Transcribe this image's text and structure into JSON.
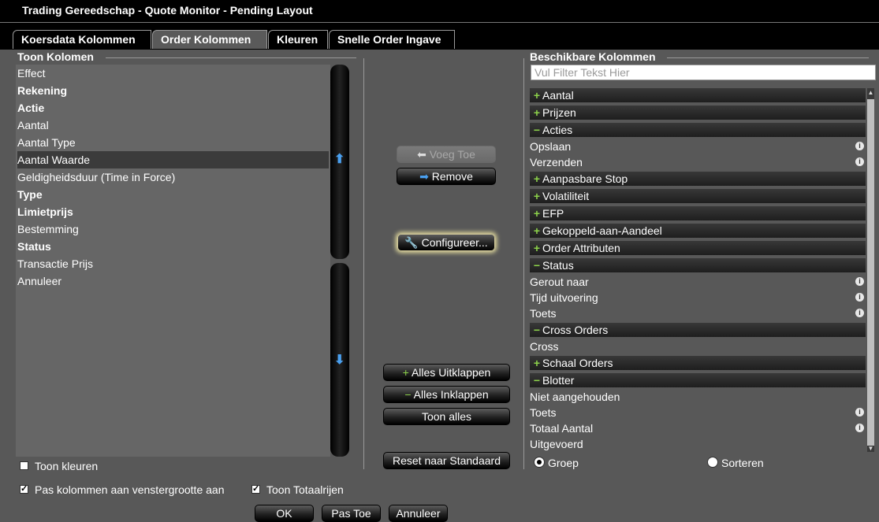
{
  "window": {
    "title": "Trading Gereedschap - Quote Monitor - Pending Layout"
  },
  "tabs": [
    {
      "label": "Koersdata Kolommen"
    },
    {
      "label": "Order Kolommen"
    },
    {
      "label": "Kleuren"
    },
    {
      "label": "Snelle Order Ingave"
    }
  ],
  "left": {
    "title": "Toon Kolomen",
    "items": [
      {
        "label": "Effect"
      },
      {
        "label": "Rekening"
      },
      {
        "label": "Actie"
      },
      {
        "label": "Aantal"
      },
      {
        "label": "Aantal Type"
      },
      {
        "label": "Aantal Waarde"
      },
      {
        "label": "Geldigheidsduur (Time in Force)"
      },
      {
        "label": "Type"
      },
      {
        "label": "Limietprijs"
      },
      {
        "label": "Bestemming"
      },
      {
        "label": "Status"
      },
      {
        "label": "Transactie Prijs"
      },
      {
        "label": "Annuleer"
      }
    ],
    "show_colors_label": "Toon kleuren"
  },
  "middle": {
    "add_label": "Voeg Toe",
    "remove_label": "Remove",
    "configure_label": "Configureer...",
    "expand_all_label": "Alles Uitklappen",
    "collapse_all_label": "Alles Inklappen",
    "show_all_label": "Toon alles",
    "reset_label": "Reset naar Standaard"
  },
  "right": {
    "title": "Beschikbare Kolommen",
    "filter_placeholder": "Vul Filter Tekst Hier",
    "groups": [
      {
        "label": "Aantal",
        "sign": "+"
      },
      {
        "label": "Prijzen",
        "sign": "+"
      },
      {
        "label": "Acties",
        "sign": "−"
      },
      {
        "label": "Opslaan",
        "item": true,
        "info": true
      },
      {
        "label": "Verzenden",
        "item": true,
        "info": true
      },
      {
        "label": "Aanpasbare Stop",
        "sign": "+"
      },
      {
        "label": "Volatiliteit",
        "sign": "+"
      },
      {
        "label": "EFP",
        "sign": "+"
      },
      {
        "label": "Gekoppeld-aan-Aandeel",
        "sign": "+"
      },
      {
        "label": "Order Attributen",
        "sign": "+"
      },
      {
        "label": "Status",
        "sign": "−"
      },
      {
        "label": "Gerout naar",
        "item": true,
        "info": true
      },
      {
        "label": "Tijd uitvoering",
        "item": true,
        "info": true
      },
      {
        "label": "Toets",
        "item": true,
        "info": true
      },
      {
        "label": "Cross Orders",
        "sign": "−"
      },
      {
        "label": "Cross",
        "item": true,
        "info": false
      },
      {
        "label": "Schaal Orders",
        "sign": "+"
      },
      {
        "label": "Blotter",
        "sign": "−"
      },
      {
        "label": "Niet aangehouden",
        "item": true,
        "info": false
      },
      {
        "label": "Toets",
        "item": true,
        "info": true
      },
      {
        "label": "Totaal Aantal",
        "item": true,
        "info": true
      },
      {
        "label": "Uitgevoerd",
        "item": true,
        "info": false
      }
    ],
    "radio_group_label": "Groep",
    "radio_sort_label": "Sorteren"
  },
  "bottom": {
    "fit_columns_label": "Pas kolommen aan venstergrootte aan",
    "show_totals_label": "Toon Totaalrijen",
    "ok_label": "OK",
    "apply_label": "Pas Toe",
    "cancel_label": "Annuleer"
  }
}
